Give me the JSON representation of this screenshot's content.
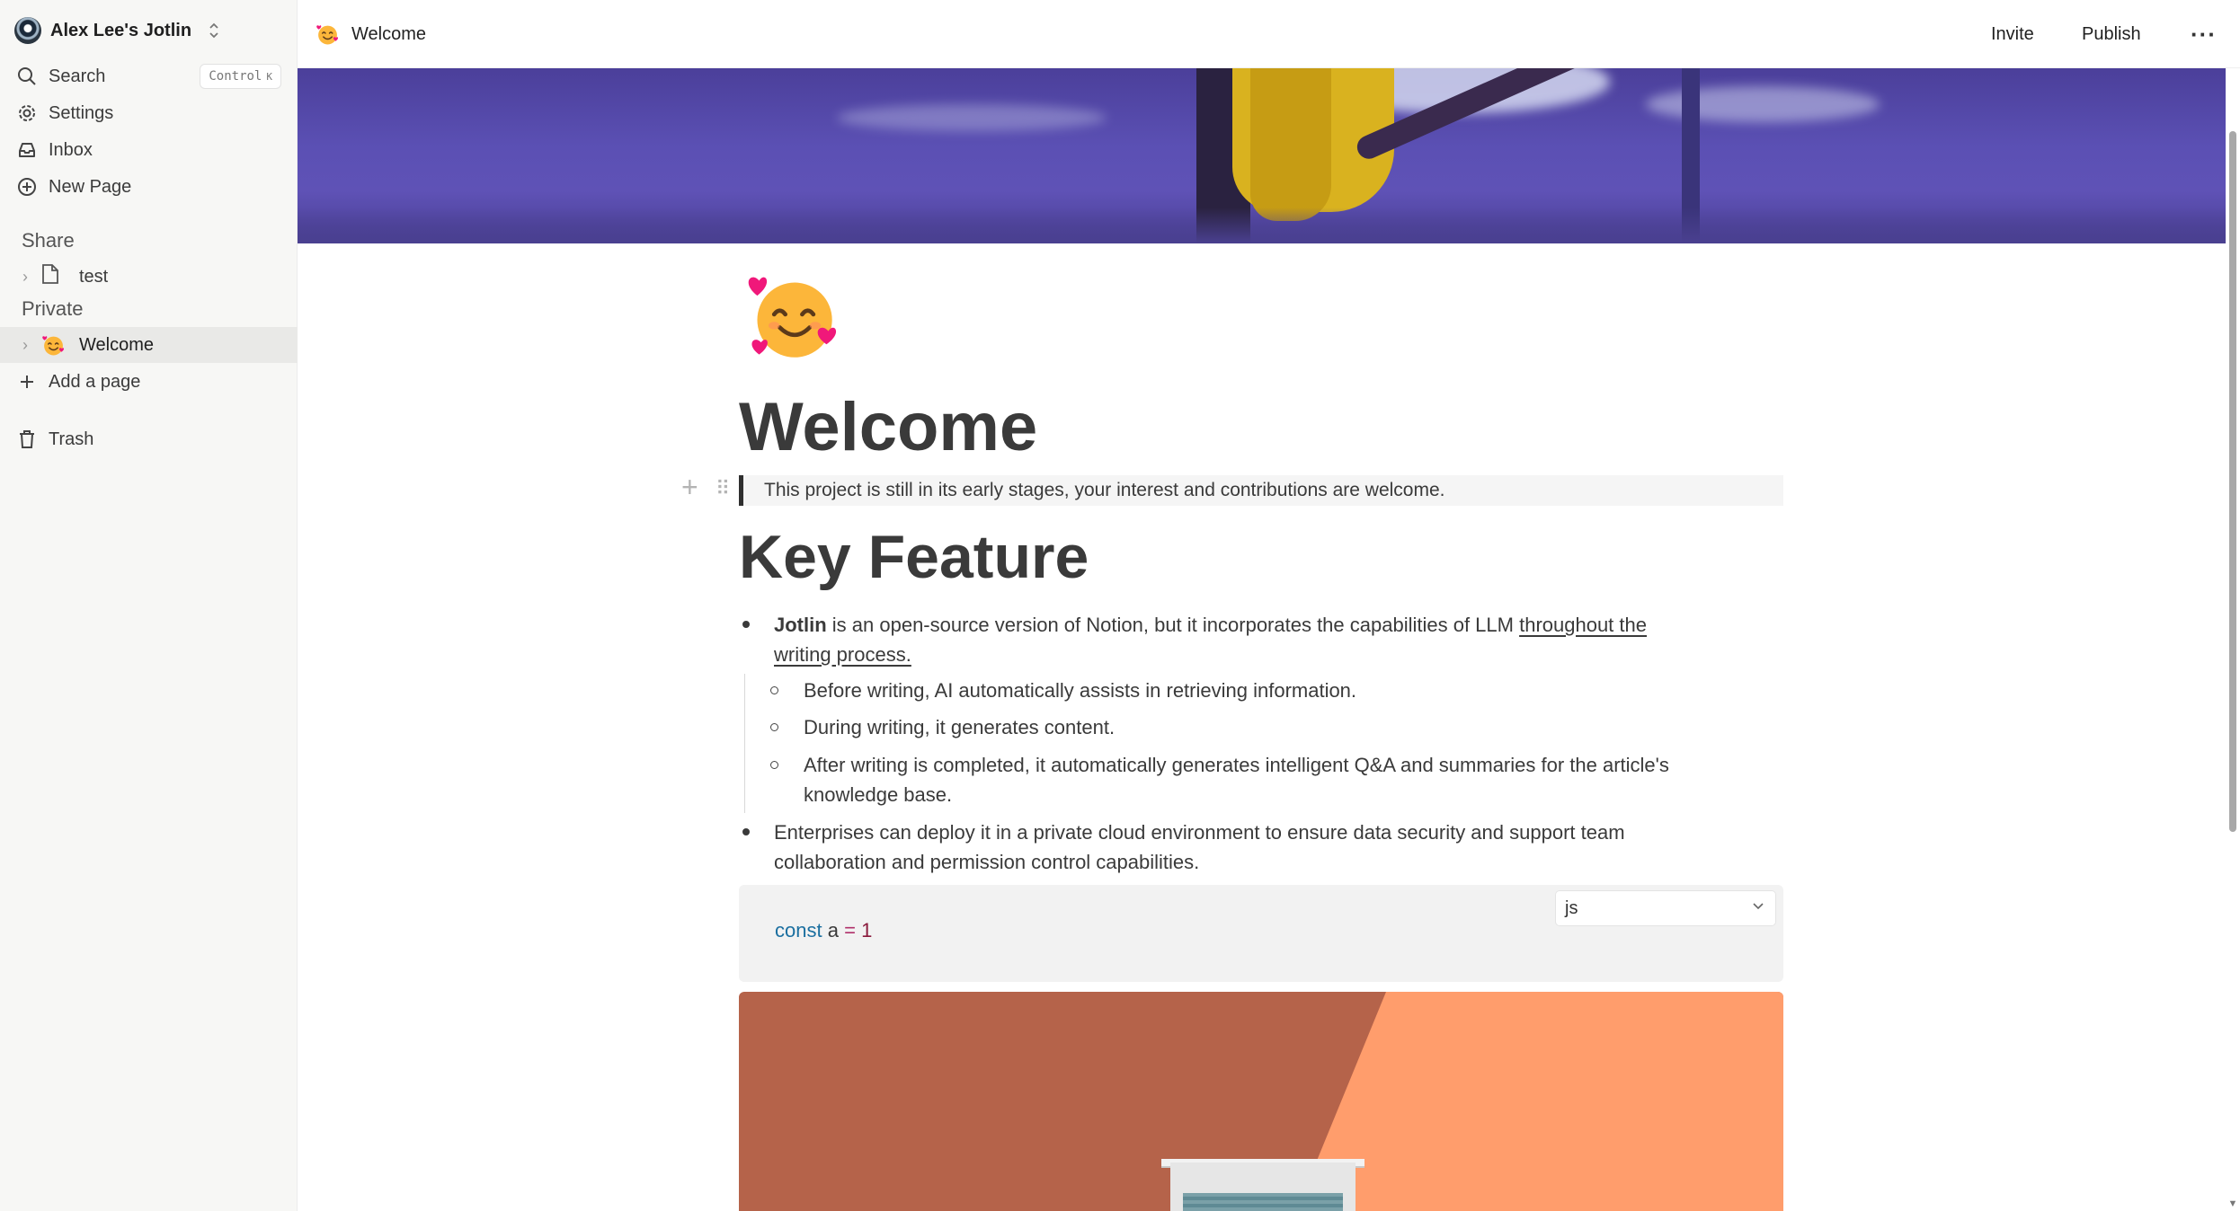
{
  "sidebar": {
    "workspace_name": "Alex Lee's Jotlin",
    "nav": {
      "search": "Search",
      "search_shortcut_key": "Control",
      "search_shortcut_letter": "K",
      "settings": "Settings",
      "inbox": "Inbox",
      "new_page": "New Page"
    },
    "share_label": "Share",
    "share_items": [
      {
        "label": "test"
      }
    ],
    "private_label": "Private",
    "private_items": [
      {
        "label": "Welcome",
        "active": true
      }
    ],
    "add_page": "Add a page",
    "trash": "Trash"
  },
  "topbar": {
    "breadcrumb": "Welcome",
    "invite": "Invite",
    "publish": "Publish"
  },
  "page": {
    "title": "Welcome",
    "quote": "This project is still in its early stages, your interest and contributions are welcome.",
    "heading": "Key Feature",
    "bullet1": {
      "bold": "Jotlin",
      "text": " is an open-source version of Notion, but it incorporates the capabilities of LLM ",
      "underlined_line1": "throughout the ",
      "underlined_line2": "writing process."
    },
    "sub_bullets": [
      "Before writing, AI automatically assists in retrieving information.",
      "During writing, it generates content.",
      "After writing is completed, it automatically generates intelligent Q&A and summaries for the article's",
      "knowledge base."
    ],
    "bullet2_line1": "Enterprises can deploy it in a private cloud environment to ensure data security and support team",
    "bullet2_line2": "collaboration and permission control capabilities.",
    "code": {
      "keyword": "const",
      "var": "a",
      "op": "=",
      "num": "1",
      "language": "js"
    }
  },
  "colors": {
    "sidebar_bg": "#f7f7f5",
    "active_item_bg": "#e9e9e7",
    "code_keyword": "#1b6fa0",
    "code_number": "#8a1a3c"
  }
}
